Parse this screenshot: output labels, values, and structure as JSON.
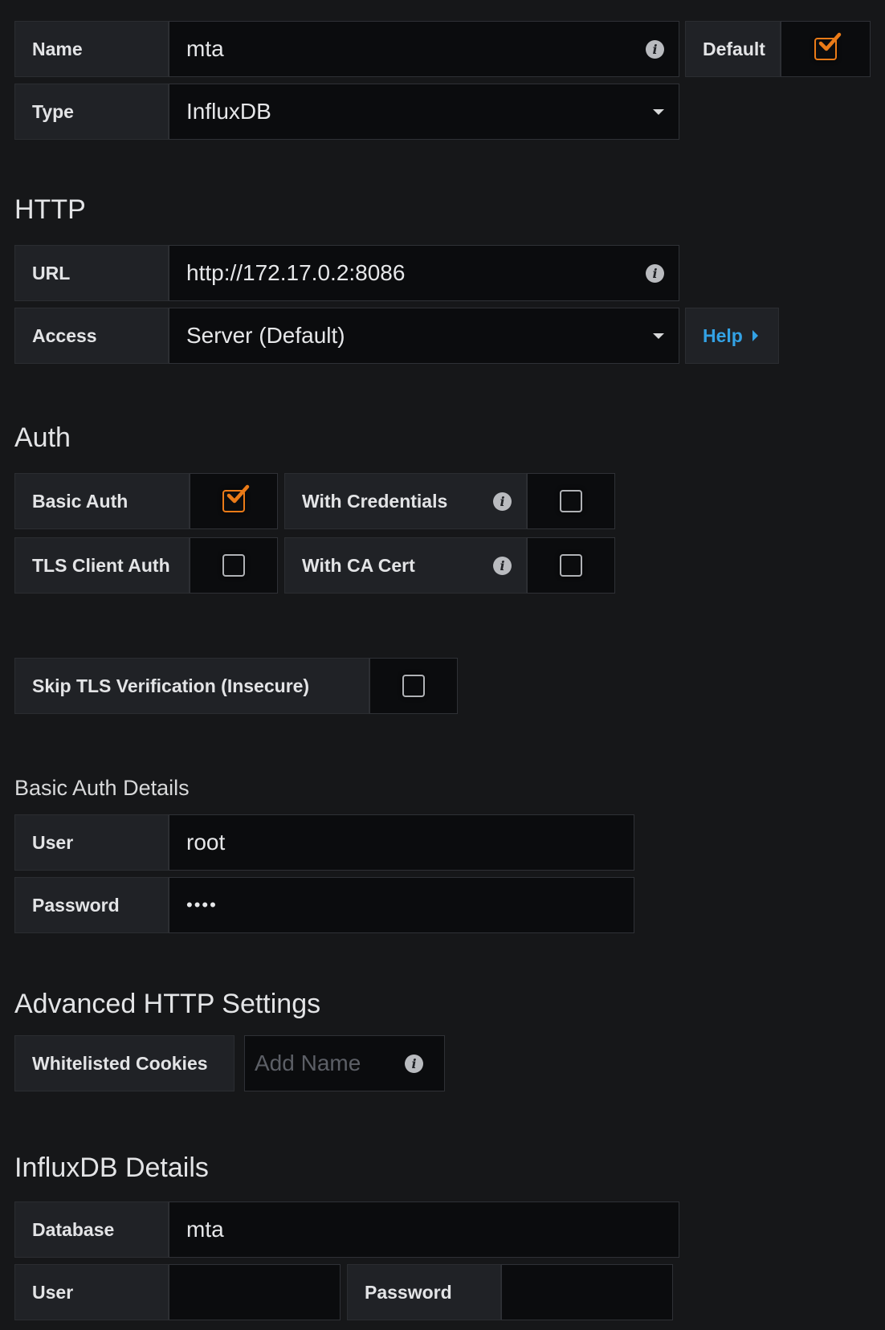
{
  "general": {
    "name_label": "Name",
    "name_value": "mta",
    "default_label": "Default",
    "default_checked": true,
    "type_label": "Type",
    "type_value": "InfluxDB"
  },
  "http": {
    "heading": "HTTP",
    "url_label": "URL",
    "url_value": "http://172.17.0.2:8086",
    "access_label": "Access",
    "access_value": "Server (Default)",
    "help_label": "Help"
  },
  "auth": {
    "heading": "Auth",
    "basic_auth_label": "Basic Auth",
    "basic_auth_checked": true,
    "with_credentials_label": "With Credentials",
    "with_credentials_checked": false,
    "tls_client_auth_label": "TLS Client Auth",
    "tls_client_auth_checked": false,
    "with_ca_cert_label": "With CA Cert",
    "with_ca_cert_checked": false,
    "skip_tls_label": "Skip TLS Verification (Insecure)",
    "skip_tls_checked": false
  },
  "basic_auth_details": {
    "heading": "Basic Auth Details",
    "user_label": "User",
    "user_value": "root",
    "password_label": "Password",
    "password_value": "••••"
  },
  "advanced_http": {
    "heading": "Advanced HTTP Settings",
    "cookies_label": "Whitelisted Cookies",
    "cookies_placeholder": "Add Name"
  },
  "influxdb_details": {
    "heading": "InfluxDB Details",
    "database_label": "Database",
    "database_value": "mta",
    "user_label": "User",
    "user_value": "",
    "password_label": "Password",
    "password_value": ""
  },
  "colors": {
    "background": "#161719",
    "label_bg": "#202226",
    "input_bg": "#0b0c0e",
    "checkbox_accent": "#eb7b18",
    "link_blue": "#33a2e5"
  }
}
